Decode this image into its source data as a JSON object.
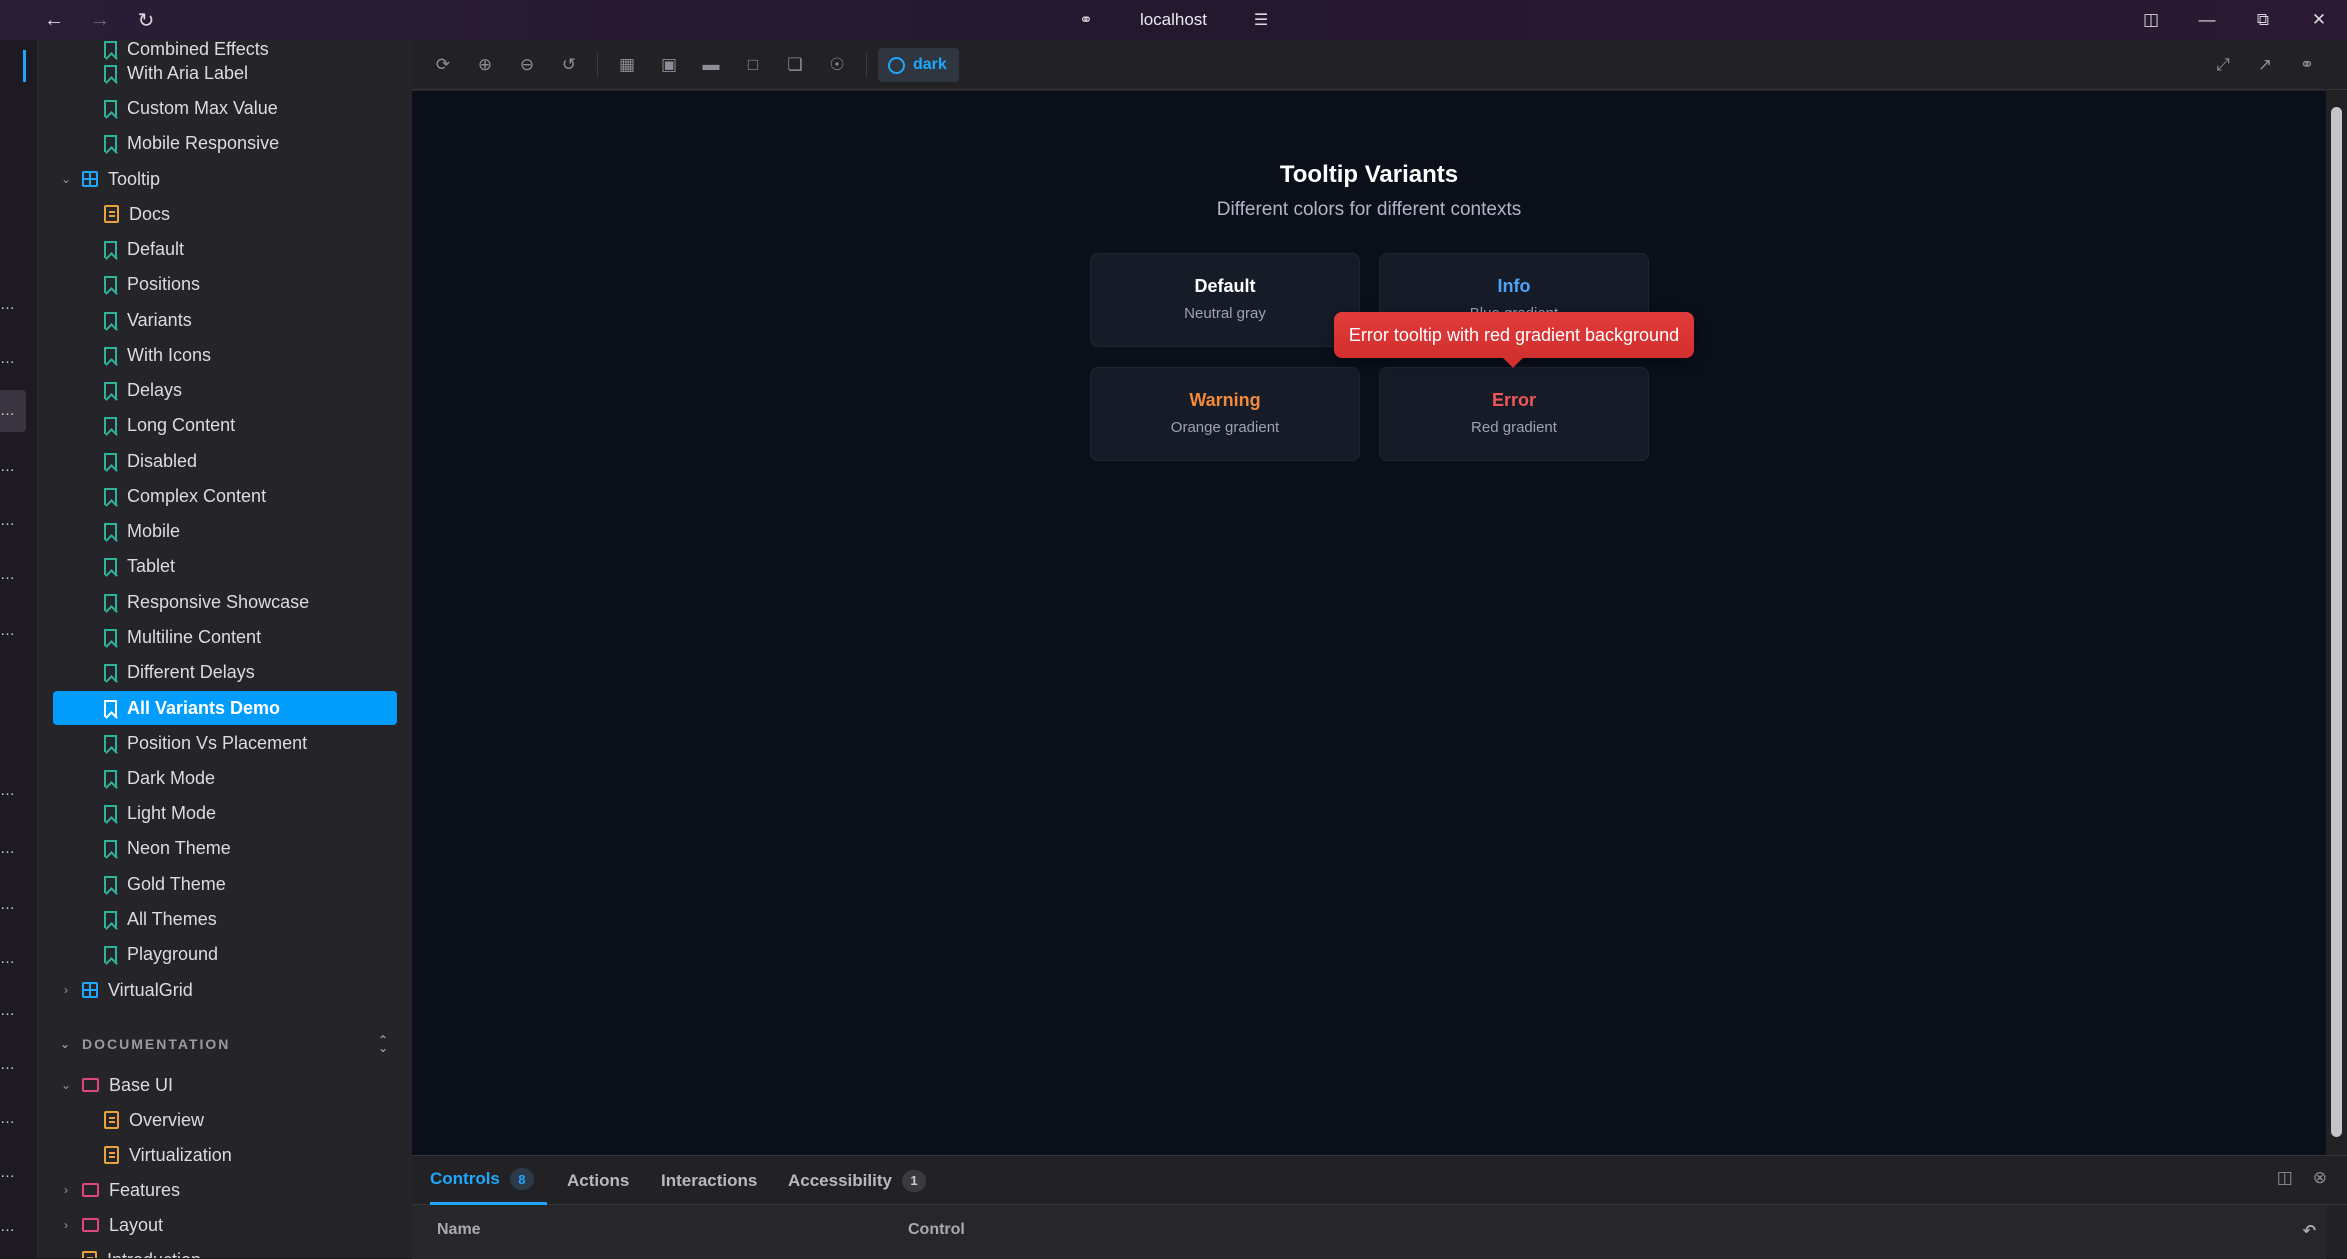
{
  "titlebar": {
    "url": "localhost"
  },
  "sidebar": {
    "items": [
      {
        "label": "Combined Effects",
        "kind": "story"
      },
      {
        "label": "With Aria Label",
        "kind": "story"
      },
      {
        "label": "Custom Max Value",
        "kind": "story"
      },
      {
        "label": "Mobile Responsive",
        "kind": "story"
      },
      {
        "label": "Tooltip",
        "kind": "component"
      },
      {
        "label": "Docs",
        "kind": "docs"
      },
      {
        "label": "Default",
        "kind": "story"
      },
      {
        "label": "Positions",
        "kind": "story"
      },
      {
        "label": "Variants",
        "kind": "story"
      },
      {
        "label": "With Icons",
        "kind": "story"
      },
      {
        "label": "Delays",
        "kind": "story"
      },
      {
        "label": "Long Content",
        "kind": "story"
      },
      {
        "label": "Disabled",
        "kind": "story"
      },
      {
        "label": "Complex Content",
        "kind": "story"
      },
      {
        "label": "Mobile",
        "kind": "story"
      },
      {
        "label": "Tablet",
        "kind": "story"
      },
      {
        "label": "Responsive Showcase",
        "kind": "story"
      },
      {
        "label": "Multiline Content",
        "kind": "story"
      },
      {
        "label": "Different Delays",
        "kind": "story"
      },
      {
        "label": "All Variants Demo",
        "kind": "story",
        "selected": true
      },
      {
        "label": "Position Vs Placement",
        "kind": "story"
      },
      {
        "label": "Dark Mode",
        "kind": "story"
      },
      {
        "label": "Light Mode",
        "kind": "story"
      },
      {
        "label": "Neon Theme",
        "kind": "story"
      },
      {
        "label": "Gold Theme",
        "kind": "story"
      },
      {
        "label": "All Themes",
        "kind": "story"
      },
      {
        "label": "Playground",
        "kind": "story"
      },
      {
        "label": "VirtualGrid",
        "kind": "component"
      }
    ],
    "section_title": "DOCUMENTATION",
    "doc_items": [
      {
        "label": "Base UI",
        "kind": "folder"
      },
      {
        "label": "Overview",
        "kind": "docs"
      },
      {
        "label": "Virtualization",
        "kind": "docs"
      },
      {
        "label": "Features",
        "kind": "folder"
      },
      {
        "label": "Layout",
        "kind": "folder"
      },
      {
        "label": "Introduction",
        "kind": "docs"
      }
    ]
  },
  "toolbar": {
    "theme_label": "dark"
  },
  "preview": {
    "title": "Tooltip Variants",
    "subtitle": "Different colors for different contexts",
    "cards": [
      {
        "title": "Default",
        "subtitle": "Neutral gray",
        "color": "#ffffff"
      },
      {
        "title": "Info",
        "subtitle": "Blue gradient",
        "color": "#4ea3f7"
      },
      {
        "title": "Warning",
        "subtitle": "Orange gradient",
        "color": "#f5893a"
      },
      {
        "title": "Error",
        "subtitle": "Red gradient",
        "color": "#f0575a"
      }
    ],
    "tooltip_text": "Error tooltip with red gradient background"
  },
  "addons": {
    "tabs": [
      {
        "label": "Controls",
        "badge": "8"
      },
      {
        "label": "Actions",
        "badge": ""
      },
      {
        "label": "Interactions",
        "badge": ""
      },
      {
        "label": "Accessibility",
        "badge": "1"
      }
    ],
    "col_name": "Name",
    "col_control": "Control"
  },
  "colors": {
    "accent": "#029cfd",
    "canvas_bg": "#0a0f1a",
    "sidebar_bg": "#252529"
  }
}
